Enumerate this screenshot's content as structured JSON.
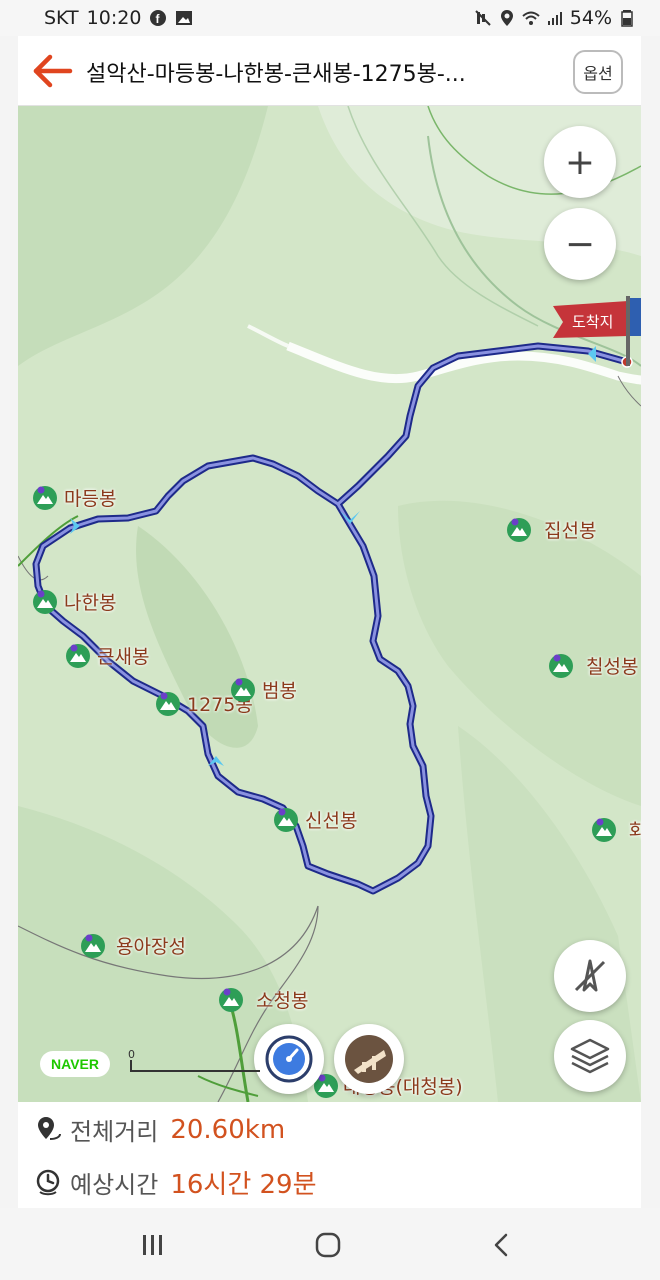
{
  "status_bar": {
    "carrier": "SKT",
    "time": "10:20",
    "battery": "54%",
    "icons": [
      "facebook-icon",
      "gallery-icon",
      "mute-icon",
      "location-icon",
      "wifi-icon",
      "signal-icon",
      "battery-icon"
    ]
  },
  "header": {
    "title": "설악산-마등봉-나한봉-큰새봉-1275봉-...",
    "options_label": "옵션"
  },
  "map": {
    "zoom_in": "+",
    "zoom_out": "−",
    "arrival_label": "도착지",
    "peaks": [
      {
        "name": "마등봉"
      },
      {
        "name": "나한봉"
      },
      {
        "name": "큰새봉"
      },
      {
        "name": "1275봉"
      },
      {
        "name": "범봉"
      },
      {
        "name": "신선봉"
      },
      {
        "name": "집선봉"
      },
      {
        "name": "칠성봉"
      },
      {
        "name": "화"
      },
      {
        "name": "용아장성"
      },
      {
        "name": "소청봉"
      },
      {
        "name": "대청봉(대청봉)"
      }
    ],
    "naver_logo": "NAVER",
    "scale_zero": "0",
    "colors": {
      "route": "#3f48c4",
      "terrain": "#cfe3c3",
      "label": "#8b3a1c",
      "river": "#ffffff"
    }
  },
  "info": {
    "distance_label": "전체거리",
    "distance_value": "20.60km",
    "time_label": "예상시간",
    "time_value": "16시간 29분"
  },
  "nav": {
    "recents": "recents-icon",
    "home": "home-icon",
    "back": "back-icon"
  }
}
